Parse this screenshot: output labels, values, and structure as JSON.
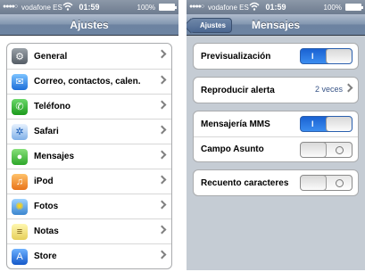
{
  "status_bar": {
    "signal": "●●●●○",
    "carrier": "vodafone ES",
    "time": "01:59",
    "battery": "100%"
  },
  "left": {
    "nav_title": "Ajustes",
    "items": [
      {
        "label": "General",
        "icon": "gear-icon",
        "glyph": "⚙"
      },
      {
        "label": "Correo, contactos, calen.",
        "icon": "mail-icon",
        "glyph": "✉"
      },
      {
        "label": "Teléfono",
        "icon": "phone-icon",
        "glyph": "✆"
      },
      {
        "label": "Safari",
        "icon": "compass-icon",
        "glyph": "✲"
      },
      {
        "label": "Mensajes",
        "icon": "message-icon",
        "glyph": "●"
      },
      {
        "label": "iPod",
        "icon": "music-icon",
        "glyph": "♫"
      },
      {
        "label": "Fotos",
        "icon": "sunflower-icon",
        "glyph": "✺"
      },
      {
        "label": "Notas",
        "icon": "notepad-icon",
        "glyph": "≡"
      },
      {
        "label": "Store",
        "icon": "app-store-icon",
        "glyph": "A"
      }
    ]
  },
  "right": {
    "back_label": "Ajustes",
    "nav_title": "Mensajes",
    "preview_label": "Previsualización",
    "preview_state": "on",
    "toggle_on_mark": "I",
    "alert_label": "Reproducir alerta",
    "alert_value": "2 veces",
    "mms_label": "Mensajería MMS",
    "mms_state": "on",
    "subject_label": "Campo Asunto",
    "subject_state": "off",
    "charcount_label": "Recuento caracteres",
    "charcount_state": "off"
  }
}
